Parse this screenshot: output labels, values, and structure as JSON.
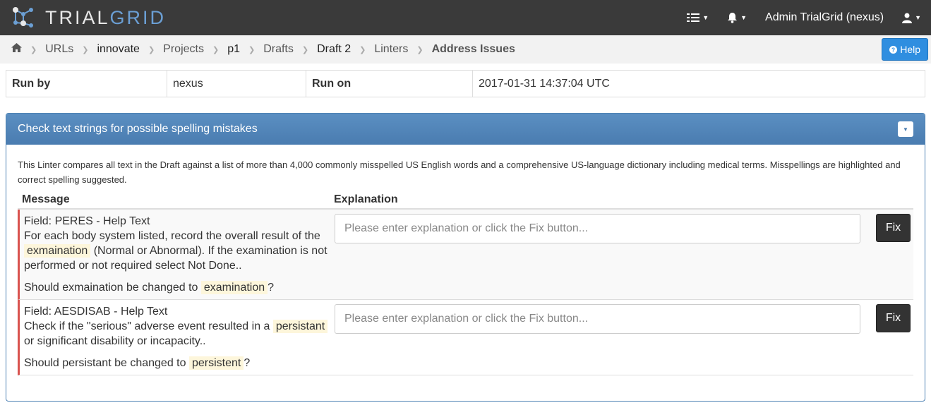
{
  "brand": {
    "name_part1": "TRIAL",
    "name_part2": "GRID"
  },
  "navbar": {
    "user_label": "Admin TrialGrid (nexus)"
  },
  "breadcrumb": {
    "items": [
      "URLs",
      "innovate",
      "Projects",
      "p1",
      "Drafts",
      "Draft 2",
      "Linters"
    ],
    "active": "Address Issues"
  },
  "help": {
    "label": "Help"
  },
  "run_info": {
    "run_by_label": "Run by",
    "run_by_value": "nexus",
    "run_on_label": "Run on",
    "run_on_value": "2017-01-31 14:37:04 UTC"
  },
  "panel": {
    "title": "Check text strings for possible spelling mistakes",
    "description": "This Linter compares all text in the Draft against a list of more than 4,000 commonly misspelled US English words and a comprehensive US-language dictionary including medical terms. Misspellings are highlighted and correct spelling suggested.",
    "col_message": "Message",
    "col_explanation": "Explanation",
    "rows": [
      {
        "field": "Field: PERES - Help Text",
        "text_before": "For each body system listed, record the overall result of the ",
        "misspelled": "exmaination",
        "text_after": " (Normal or Abnormal). If the examination is not performed or not required select Not Done..",
        "question_before": "Should exmaination be changed to ",
        "suggestion": "examination",
        "question_after": "?",
        "placeholder": "Please enter explanation or click the Fix button...",
        "fix_label": "Fix"
      },
      {
        "field": "Field: AESDISAB - Help Text",
        "text_before": "Check if the \"serious\" adverse event resulted in a ",
        "misspelled": "persistant",
        "text_after": " or significant disability or incapacity..",
        "question_before": "Should persistant be changed to ",
        "suggestion": "persistent",
        "question_after": "?",
        "placeholder": "Please enter explanation or click the Fix button...",
        "fix_label": "Fix"
      }
    ]
  },
  "colors": {
    "navbar_bg": "#3a3a3a",
    "brand_accent": "#6b9fd4",
    "panel_header": "#4a7cb0",
    "help_button": "#2f8ee0",
    "issue_marker": "#d9534f",
    "highlight": "#fdf6db"
  },
  "icons": {
    "logo": "molecule-logo-icon",
    "home": "home-icon",
    "menu": "list-menu-icon",
    "notifications": "bell-icon",
    "user": "user-icon",
    "help": "question-circle-icon",
    "collapse": "chevron-down-icon"
  }
}
